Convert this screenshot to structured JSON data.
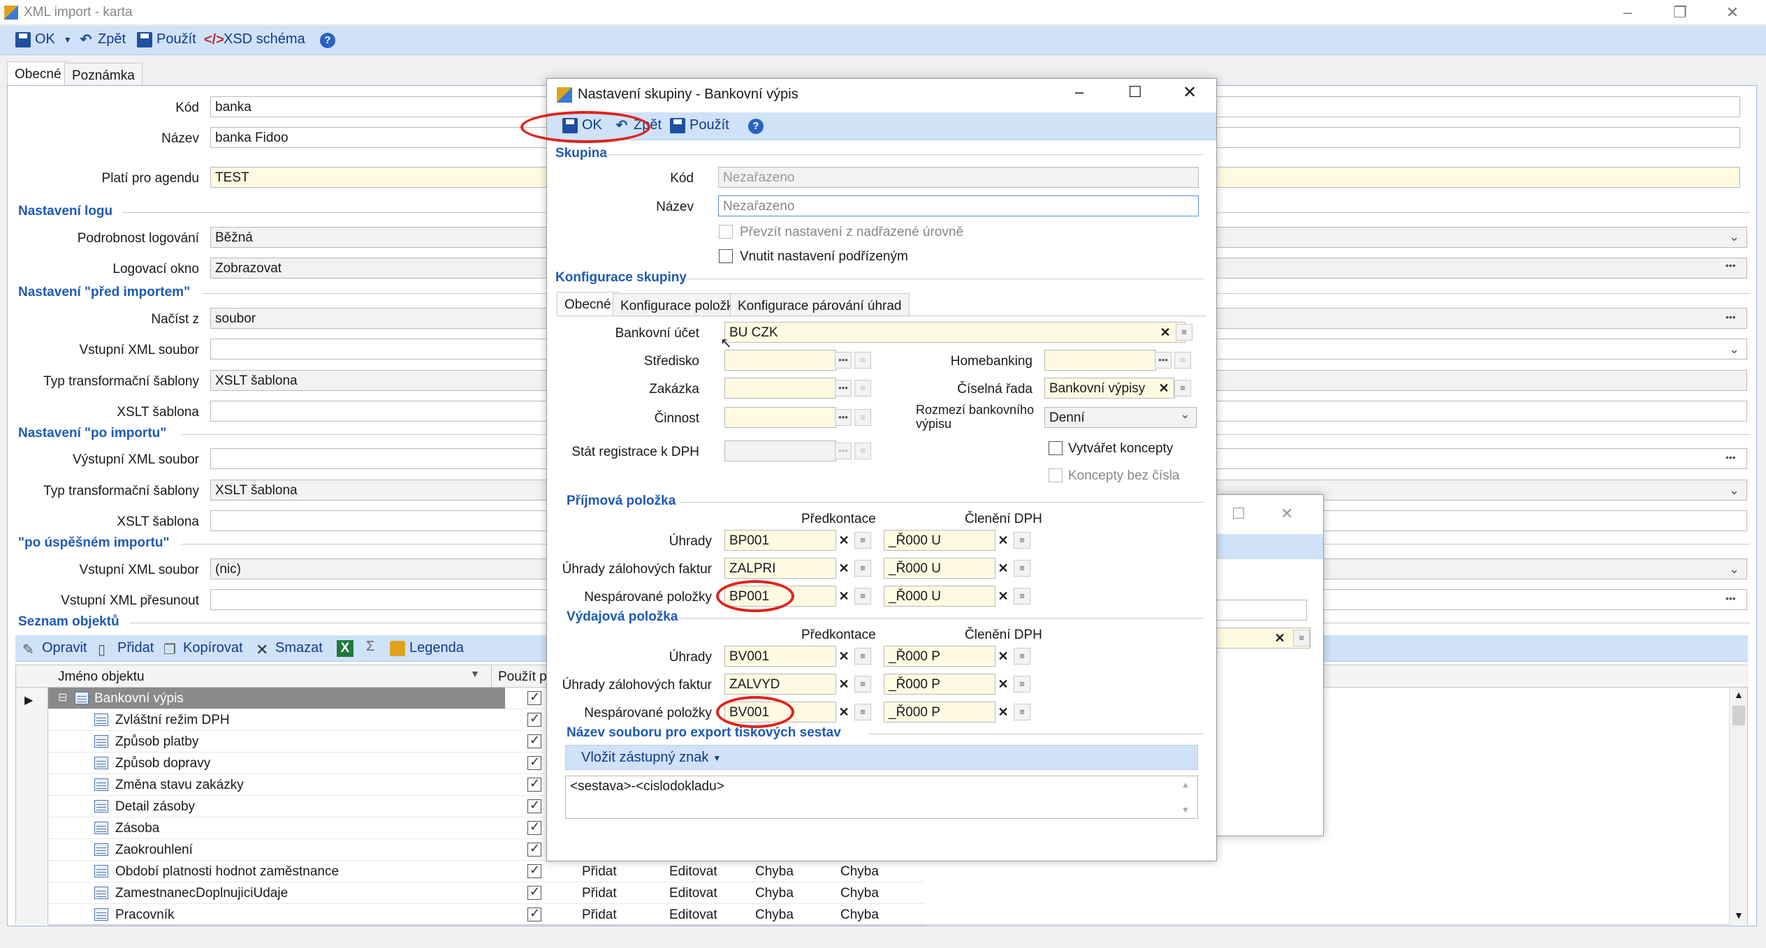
{
  "window": {
    "title": "XML import - karta",
    "min": "–",
    "restore": "❐",
    "close": "✕"
  },
  "toolbar": {
    "ok": "OK",
    "back": "Zpět",
    "apply": "Použít",
    "xsd": "XSD schéma",
    "help": "?"
  },
  "tabs": [
    "Obecné",
    "Poznámka"
  ],
  "form": {
    "kod_label": "Kód",
    "kod": "banka",
    "nazev_label": "Název",
    "nazev": "banka Fidoo",
    "agenda_label": "Platí pro agendu",
    "agenda": "TEST",
    "sec_log": "Nastavení logu",
    "podrobnost_label": "Podrobnost logování",
    "podrobnost": "Běžná",
    "logokno_label": "Logovací okno",
    "logokno": "Zobrazovat",
    "sec_pred": "Nastavení \"před importem\"",
    "nacist_label": "Načíst z",
    "nacist": "soubor",
    "vstup_label": "Vstupní XML soubor",
    "vstup": "",
    "typ_label": "Typ transformační šablony",
    "typ": "XSLT šablona",
    "xslt_label": "XSLT šablona",
    "xslt": "",
    "sec_po": "Nastavení \"po importu\"",
    "vystup_label": "Výstupní XML soubor",
    "vystup": "",
    "typ2_label": "Typ transformační šablony",
    "typ2": "XSLT šablona",
    "xslt2_label": "XSLT šablona",
    "xslt2": "",
    "sec_uspech": "\"po úspěšném importu\"",
    "vstup2_label": "Vstupní XML soubor",
    "vstup2": "(nic)",
    "presun_label": "Vstupní XML přesunout",
    "presun": "",
    "sec_seznam": "Seznam objektů"
  },
  "list_toolbar": {
    "edit": "Opravit",
    "add": "Přidat",
    "copy": "Kopírovat",
    "delete": "Smazat",
    "sum": "Σ",
    "legend": "Legenda"
  },
  "grid": {
    "col_name": "Jméno objektu",
    "col_use": "Použít pr",
    "rows": [
      {
        "name": "Bankovní výpis",
        "c1": "",
        "c2": "",
        "c3": "",
        "c4": ""
      },
      {
        "name": "Zvláštní režim DPH",
        "c1": "",
        "c2": "",
        "c3": "",
        "c4": ""
      },
      {
        "name": "Způsob platby",
        "c1": "",
        "c2": "",
        "c3": "",
        "c4": ""
      },
      {
        "name": "Způsob dopravy",
        "c1": "",
        "c2": "",
        "c3": "",
        "c4": ""
      },
      {
        "name": "Změna stavu zakázky",
        "c1": "",
        "c2": "",
        "c3": "",
        "c4": ""
      },
      {
        "name": "Detail zásoby",
        "c1": "",
        "c2": "",
        "c3": "",
        "c4": ""
      },
      {
        "name": "Zásoba",
        "c1": "",
        "c2": "",
        "c3": "",
        "c4": ""
      },
      {
        "name": "Zaokrouhlení",
        "c1": "",
        "c2": "",
        "c3": "",
        "c4": ""
      },
      {
        "name": "Období platnosti hodnot zaměstnance",
        "c1": "Přidat",
        "c2": "Editovat",
        "c3": "Chyba",
        "c4": "Chyba"
      },
      {
        "name": "ZamestnanecDoplnujiciUdaje",
        "c1": "Přidat",
        "c2": "Editovat",
        "c3": "Chyba",
        "c4": "Chyba"
      },
      {
        "name": "Pracovník",
        "c1": "Přidat",
        "c2": "Editovat",
        "c3": "Chyba",
        "c4": "Chyba"
      }
    ]
  },
  "dialog": {
    "title": "Nastavení skupiny - Bankovní výpis",
    "toolbar": {
      "ok": "OK",
      "back": "Zpět",
      "apply": "Použít",
      "help": "?"
    },
    "sec_skupina": "Skupina",
    "kod_label": "Kód",
    "kod": "Nezařazeno",
    "nazev_label": "Název",
    "nazev": "Nezařazeno",
    "prevzit": "Převzít nastavení z nadřazené úrovně",
    "vnutit": "Vnutit nastavení podřízeným",
    "sec_konfig": "Konfigurace skupiny",
    "tabs": [
      "Obecné",
      "Konfigurace položky",
      "Konfigurace párování úhrad"
    ],
    "ucet_label": "Bankovní účet",
    "ucet": "BU CZK",
    "stredisko_label": "Středisko",
    "zakazka_label": "Zakázka",
    "cinnost_label": "Činnost",
    "stat_label": "Stát registrace k DPH",
    "homebanking_label": "Homebanking",
    "rada_label": "Číselná řada",
    "rada": "Bankovní výpisy",
    "rozmezi_label1": "Rozmezí bankovního",
    "rozmezi_label2": "výpisu",
    "rozmezi": "Denní",
    "koncepty": "Vytvářet koncepty",
    "koncepty_bez": "Koncepty bez čísla",
    "sec_prijem": "Příjmová položka",
    "sec_vydaj": "Výdajová položka",
    "col_pred": "Předkontace",
    "col_cleneni": "Členění DPH",
    "uhrady_label": "Úhrady",
    "zalohy_label": "Úhrady zálohových faktur",
    "nesparovane_label": "Nespárované položky",
    "prijem": {
      "uhrady": "BP001",
      "zalohy": "ZALPRI",
      "nesp": "BP001",
      "dph1": "_Ř000 U",
      "dph2": "_Ř000 U",
      "dph3": "_Ř000 U"
    },
    "vydaj": {
      "uhrady": "BV001",
      "zalohy": "ZALVYD",
      "nesp": "BV001",
      "dph1": "_Ř000 P",
      "dph2": "_Ř000 P",
      "dph3": "_Ř000 P"
    },
    "sec_export": "Název souboru pro export tiskových sestav",
    "vlozit": "Vložit zástupný znak",
    "sablona": "<sestava>-<cislodokladu>"
  }
}
